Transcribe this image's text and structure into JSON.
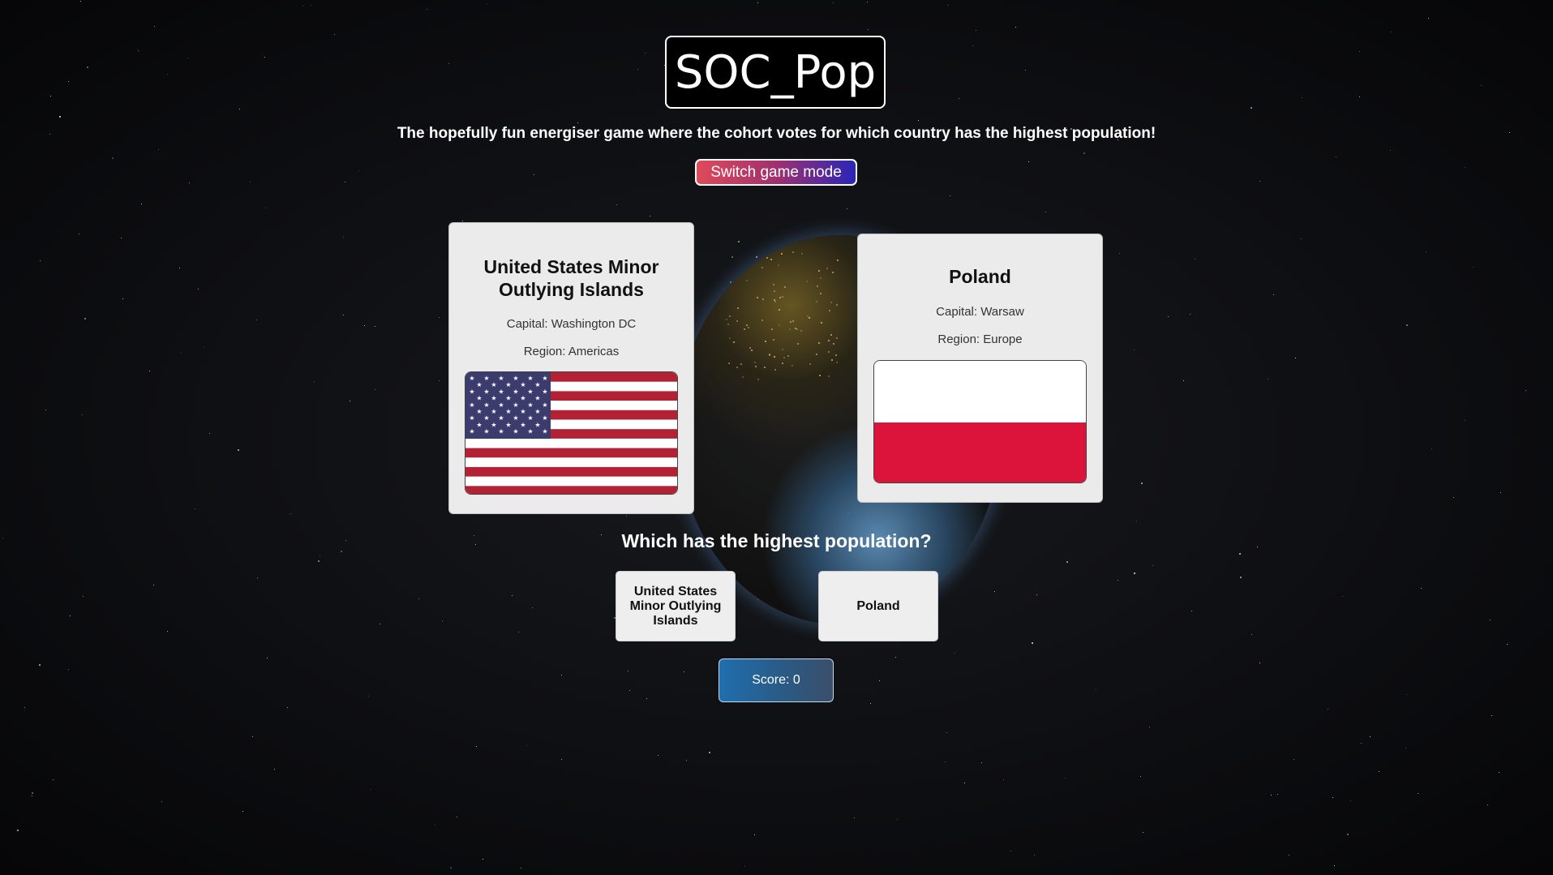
{
  "header": {
    "title": "SOC_Pop",
    "subtitle": "The hopefully fun energiser game where the cohort votes for which country has the highest population!",
    "switch_mode_label": "Switch game mode"
  },
  "cards": [
    {
      "name": "United States Minor Outlying Islands",
      "capital": "Capital: Washington DC",
      "region": "Region: Americas",
      "flag": "us-flag"
    },
    {
      "name": "Poland",
      "capital": "Capital: Warsaw",
      "region": "Region: Europe",
      "flag": "poland-flag"
    }
  ],
  "question": "Which has the highest population?",
  "choices": [
    "United States Minor Outlying Islands",
    "Poland"
  ],
  "score_label": "Score: 0",
  "colors": {
    "us_red": "#b22234",
    "us_blue": "#3c3b6e",
    "poland_red": "#dc143c",
    "score_blue": "#1f6fae"
  }
}
